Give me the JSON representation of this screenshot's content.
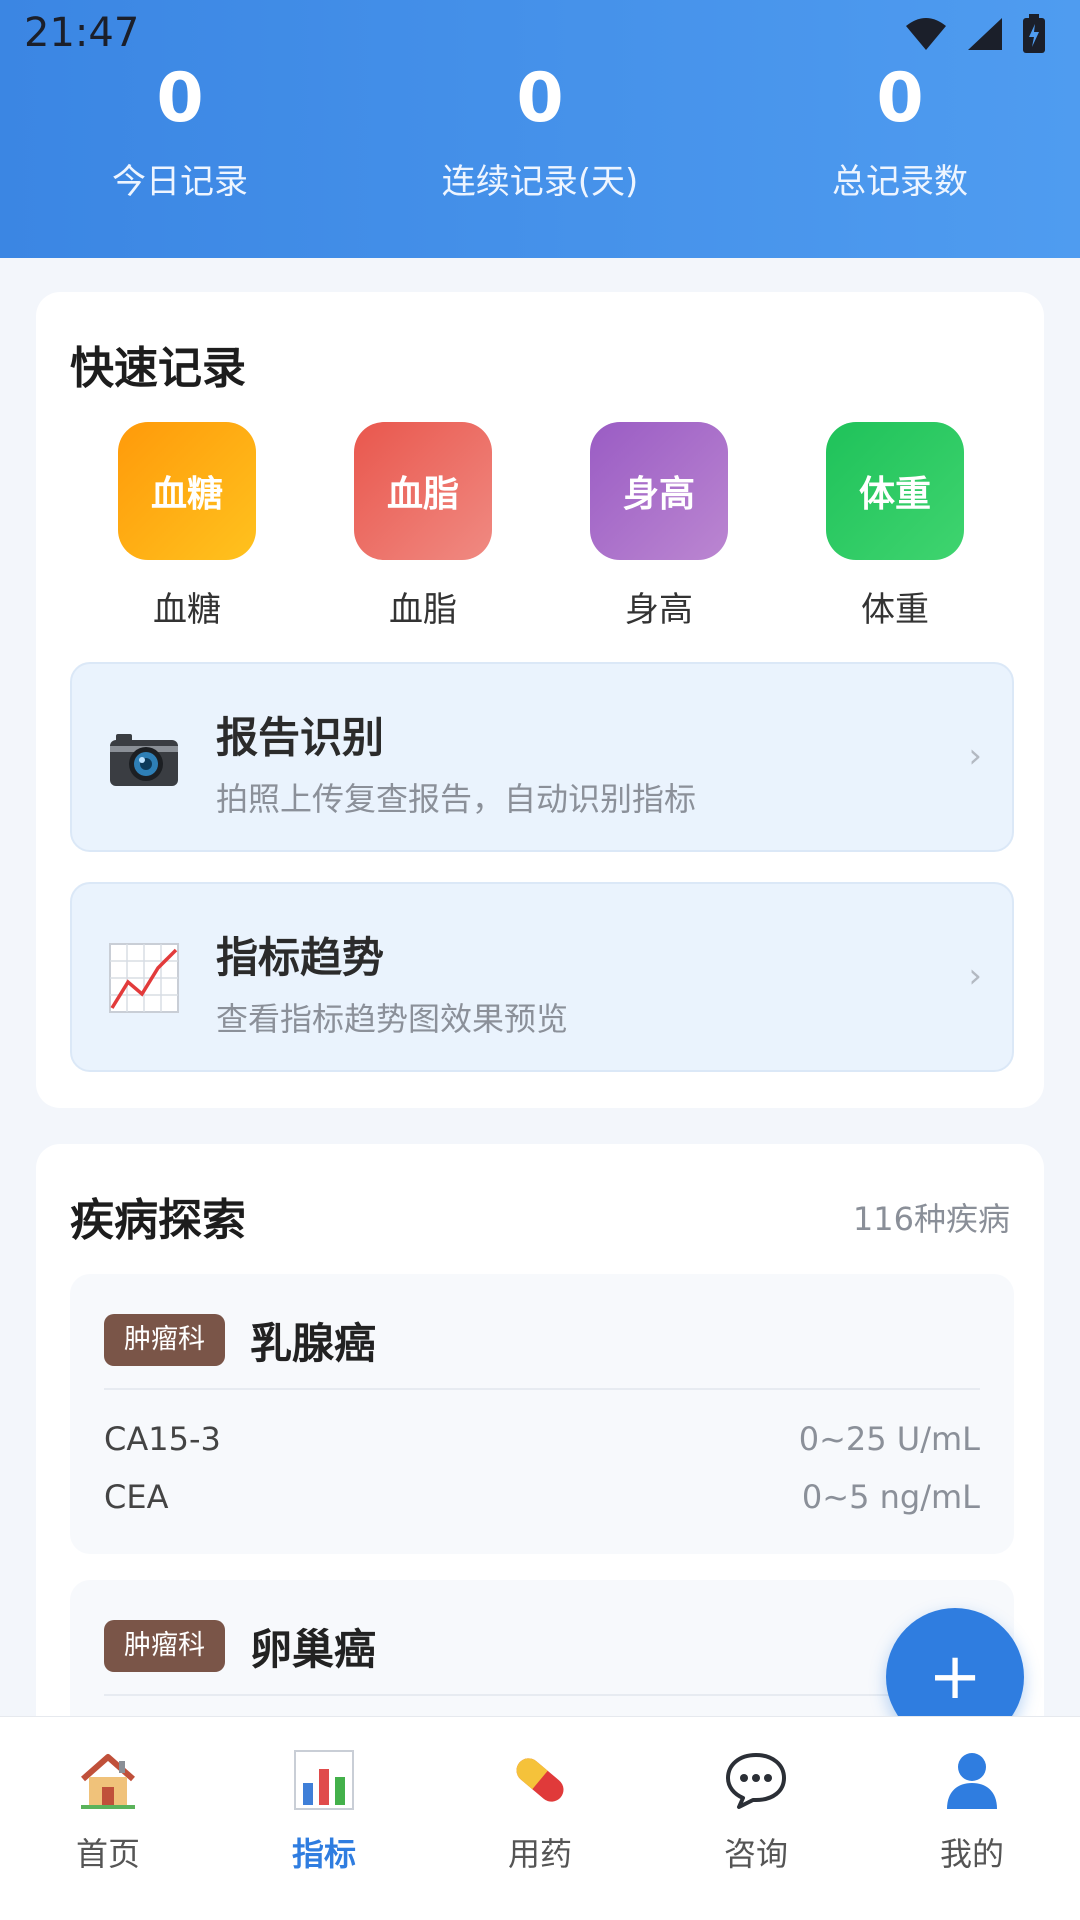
{
  "status_bar": {
    "time": "21:47"
  },
  "stats": [
    {
      "value": "0",
      "label": "今日记录"
    },
    {
      "value": "0",
      "label": "连续记录(天)"
    },
    {
      "value": "0",
      "label": "总记录数"
    }
  ],
  "quick": {
    "title": "快速记录",
    "items": [
      {
        "tile": "血糖",
        "label": "血糖",
        "color": "#ffae16"
      },
      {
        "tile": "血脂",
        "label": "血脂",
        "color": "#ec6b62"
      },
      {
        "tile": "身高",
        "label": "身高",
        "color": "#a76bc7"
      },
      {
        "tile": "体重",
        "label": "体重",
        "color": "#2ecb62"
      }
    ],
    "features": [
      {
        "icon": "camera-icon",
        "title": "报告识别",
        "subtitle": "拍照上传复查报告，自动识别指标"
      },
      {
        "icon": "trend-chart-icon",
        "title": "指标趋势",
        "subtitle": "查看指标趋势图效果预览"
      }
    ]
  },
  "disease": {
    "title": "疾病探索",
    "count": "116种疾病",
    "items": [
      {
        "dept": "肿瘤科",
        "name": "乳腺癌",
        "metrics": [
          {
            "name": "CA15-3",
            "range": "0~25 U/mL"
          },
          {
            "name": "CEA",
            "range": "0~5 ng/mL"
          }
        ]
      },
      {
        "dept": "肿瘤科",
        "name": "卵巢癌"
      }
    ]
  },
  "fab": {
    "label": "+"
  },
  "nav": [
    {
      "label": "首页",
      "icon": "home-icon"
    },
    {
      "label": "指标",
      "icon": "bar-chart-icon",
      "active": true
    },
    {
      "label": "用药",
      "icon": "pill-icon"
    },
    {
      "label": "咨询",
      "icon": "chat-bubble-icon"
    },
    {
      "label": "我的",
      "icon": "user-icon"
    }
  ]
}
